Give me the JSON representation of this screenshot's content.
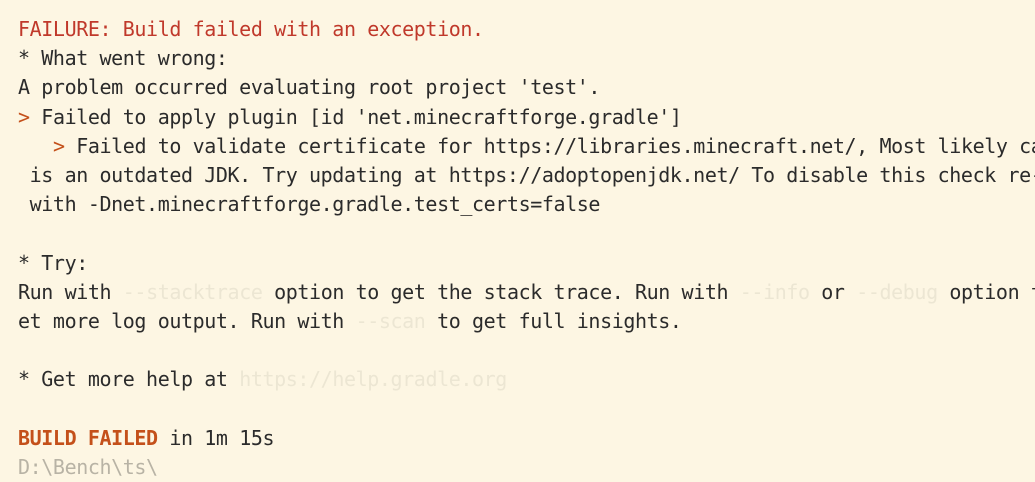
{
  "colors": {
    "background": "#fdf6e3",
    "text": "#2b2b2b",
    "error": "#c0392b",
    "build_failed": "#c4501a",
    "faint_highlight": "#ece6d3"
  },
  "output": {
    "failure_line": "FAILURE: Build failed with an exception.",
    "what_went_wrong": "* What went wrong:",
    "problem_line": "A problem occurred evaluating root project 'test'.",
    "arrow1": ">",
    "apply_plugin": " Failed to apply plugin [id 'net.minecraftforge.gradle']",
    "arrow2": ">",
    "cert_line1": " Failed to validate certificate for https://libraries.minecraft.net/, Most likely cause",
    "cert_line2": " is an outdated JDK. Try updating at https://adoptopenjdk.net/ To disable this check re-run",
    "cert_line3": " with -Dnet.minecraftforge.gradle.test_certs=false",
    "try_header": "* Try:",
    "run_with_1": "Run with ",
    "stacktrace_opt": "--stacktrace",
    "mid_1": " option to get the stack trace. Run with ",
    "info_opt": "--info",
    "or": " or ",
    "debug_opt": "--debug",
    "end_1": " option to g",
    "cont_2": "et more log output. Run with ",
    "scan_opt": "--scan",
    "end_2": " to get full insights.",
    "help_prefix": "* Get more help at ",
    "help_url": "https://help.gradle.org",
    "build_failed": "BUILD FAILED",
    "duration": " in 1m 15s",
    "cut_line": "D:\\Bench\\ts\\"
  }
}
